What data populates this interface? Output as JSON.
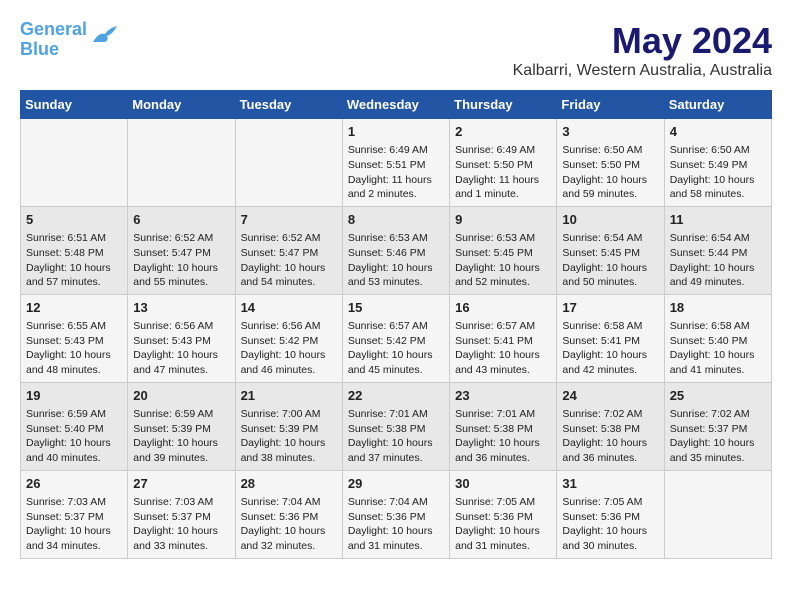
{
  "logo": {
    "line1": "General",
    "line2": "Blue"
  },
  "title": "May 2024",
  "subtitle": "Kalbarri, Western Australia, Australia",
  "days_of_week": [
    "Sunday",
    "Monday",
    "Tuesday",
    "Wednesday",
    "Thursday",
    "Friday",
    "Saturday"
  ],
  "weeks": [
    [
      {
        "day": "",
        "info": ""
      },
      {
        "day": "",
        "info": ""
      },
      {
        "day": "",
        "info": ""
      },
      {
        "day": "1",
        "info": "Sunrise: 6:49 AM\nSunset: 5:51 PM\nDaylight: 11 hours\nand 2 minutes."
      },
      {
        "day": "2",
        "info": "Sunrise: 6:49 AM\nSunset: 5:50 PM\nDaylight: 11 hours\nand 1 minute."
      },
      {
        "day": "3",
        "info": "Sunrise: 6:50 AM\nSunset: 5:50 PM\nDaylight: 10 hours\nand 59 minutes."
      },
      {
        "day": "4",
        "info": "Sunrise: 6:50 AM\nSunset: 5:49 PM\nDaylight: 10 hours\nand 58 minutes."
      }
    ],
    [
      {
        "day": "5",
        "info": "Sunrise: 6:51 AM\nSunset: 5:48 PM\nDaylight: 10 hours\nand 57 minutes."
      },
      {
        "day": "6",
        "info": "Sunrise: 6:52 AM\nSunset: 5:47 PM\nDaylight: 10 hours\nand 55 minutes."
      },
      {
        "day": "7",
        "info": "Sunrise: 6:52 AM\nSunset: 5:47 PM\nDaylight: 10 hours\nand 54 minutes."
      },
      {
        "day": "8",
        "info": "Sunrise: 6:53 AM\nSunset: 5:46 PM\nDaylight: 10 hours\nand 53 minutes."
      },
      {
        "day": "9",
        "info": "Sunrise: 6:53 AM\nSunset: 5:45 PM\nDaylight: 10 hours\nand 52 minutes."
      },
      {
        "day": "10",
        "info": "Sunrise: 6:54 AM\nSunset: 5:45 PM\nDaylight: 10 hours\nand 50 minutes."
      },
      {
        "day": "11",
        "info": "Sunrise: 6:54 AM\nSunset: 5:44 PM\nDaylight: 10 hours\nand 49 minutes."
      }
    ],
    [
      {
        "day": "12",
        "info": "Sunrise: 6:55 AM\nSunset: 5:43 PM\nDaylight: 10 hours\nand 48 minutes."
      },
      {
        "day": "13",
        "info": "Sunrise: 6:56 AM\nSunset: 5:43 PM\nDaylight: 10 hours\nand 47 minutes."
      },
      {
        "day": "14",
        "info": "Sunrise: 6:56 AM\nSunset: 5:42 PM\nDaylight: 10 hours\nand 46 minutes."
      },
      {
        "day": "15",
        "info": "Sunrise: 6:57 AM\nSunset: 5:42 PM\nDaylight: 10 hours\nand 45 minutes."
      },
      {
        "day": "16",
        "info": "Sunrise: 6:57 AM\nSunset: 5:41 PM\nDaylight: 10 hours\nand 43 minutes."
      },
      {
        "day": "17",
        "info": "Sunrise: 6:58 AM\nSunset: 5:41 PM\nDaylight: 10 hours\nand 42 minutes."
      },
      {
        "day": "18",
        "info": "Sunrise: 6:58 AM\nSunset: 5:40 PM\nDaylight: 10 hours\nand 41 minutes."
      }
    ],
    [
      {
        "day": "19",
        "info": "Sunrise: 6:59 AM\nSunset: 5:40 PM\nDaylight: 10 hours\nand 40 minutes."
      },
      {
        "day": "20",
        "info": "Sunrise: 6:59 AM\nSunset: 5:39 PM\nDaylight: 10 hours\nand 39 minutes."
      },
      {
        "day": "21",
        "info": "Sunrise: 7:00 AM\nSunset: 5:39 PM\nDaylight: 10 hours\nand 38 minutes."
      },
      {
        "day": "22",
        "info": "Sunrise: 7:01 AM\nSunset: 5:38 PM\nDaylight: 10 hours\nand 37 minutes."
      },
      {
        "day": "23",
        "info": "Sunrise: 7:01 AM\nSunset: 5:38 PM\nDaylight: 10 hours\nand 36 minutes."
      },
      {
        "day": "24",
        "info": "Sunrise: 7:02 AM\nSunset: 5:38 PM\nDaylight: 10 hours\nand 36 minutes."
      },
      {
        "day": "25",
        "info": "Sunrise: 7:02 AM\nSunset: 5:37 PM\nDaylight: 10 hours\nand 35 minutes."
      }
    ],
    [
      {
        "day": "26",
        "info": "Sunrise: 7:03 AM\nSunset: 5:37 PM\nDaylight: 10 hours\nand 34 minutes."
      },
      {
        "day": "27",
        "info": "Sunrise: 7:03 AM\nSunset: 5:37 PM\nDaylight: 10 hours\nand 33 minutes."
      },
      {
        "day": "28",
        "info": "Sunrise: 7:04 AM\nSunset: 5:36 PM\nDaylight: 10 hours\nand 32 minutes."
      },
      {
        "day": "29",
        "info": "Sunrise: 7:04 AM\nSunset: 5:36 PM\nDaylight: 10 hours\nand 31 minutes."
      },
      {
        "day": "30",
        "info": "Sunrise: 7:05 AM\nSunset: 5:36 PM\nDaylight: 10 hours\nand 31 minutes."
      },
      {
        "day": "31",
        "info": "Sunrise: 7:05 AM\nSunset: 5:36 PM\nDaylight: 10 hours\nand 30 minutes."
      },
      {
        "day": "",
        "info": ""
      }
    ]
  ]
}
